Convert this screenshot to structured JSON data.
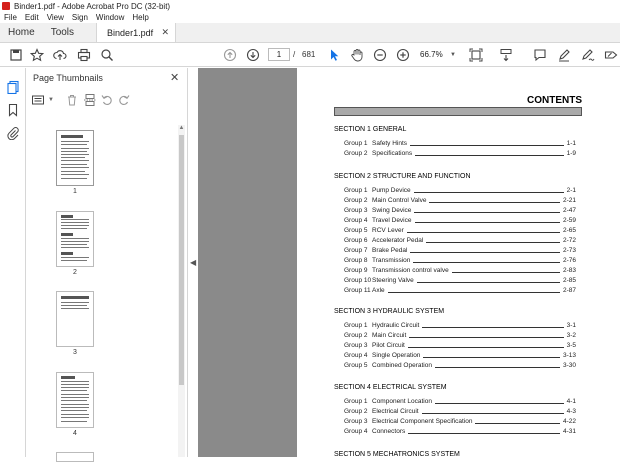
{
  "window": {
    "title": "Binder1.pdf - Adobe Acrobat Pro DC (32-bit)"
  },
  "menu": [
    "File",
    "Edit",
    "View",
    "Sign",
    "Window",
    "Help"
  ],
  "tabs": {
    "home": "Home",
    "tools": "Tools",
    "document": "Binder1.pdf"
  },
  "toolbar": {
    "page_current": "1",
    "page_separator": "/",
    "page_total": "681",
    "zoom": "66.7%"
  },
  "panel": {
    "title": "Page Thumbnails",
    "thumbnails": [
      "1",
      "2",
      "3",
      "4"
    ]
  },
  "document": {
    "contents_title": "CONTENTS",
    "sections": [
      {
        "title": "SECTION 1  GENERAL",
        "rows": [
          {
            "group": "Group  1",
            "name": "Safety Hints",
            "page": "1-1"
          },
          {
            "group": "Group  2",
            "name": "Specifications",
            "page": "1-9"
          }
        ]
      },
      {
        "title": "SECTION 2  STRUCTURE AND FUNCTION",
        "rows": [
          {
            "group": "Group  1",
            "name": "Pump Device",
            "page": "2-1"
          },
          {
            "group": "Group  2",
            "name": "Main Control Valve",
            "page": "2-21"
          },
          {
            "group": "Group  3",
            "name": "Swing Device",
            "page": "2-47"
          },
          {
            "group": "Group  4",
            "name": "Travel Device",
            "page": "2-59"
          },
          {
            "group": "Group  5",
            "name": "RCV Lever",
            "page": "2-65"
          },
          {
            "group": "Group  6",
            "name": "Accelerator Pedal",
            "page": "2-72"
          },
          {
            "group": "Group  7",
            "name": "Brake Pedal",
            "page": "2-73"
          },
          {
            "group": "Group  8",
            "name": "Transmission",
            "page": "2-76"
          },
          {
            "group": "Group  9",
            "name": "Transmission control valve",
            "page": "2-83"
          },
          {
            "group": "Group 10",
            "name": "Steering Valve",
            "page": "2-85"
          },
          {
            "group": "Group 11",
            "name": "Axle",
            "page": "2-87"
          }
        ]
      },
      {
        "title": "SECTION 3  HYDRAULIC SYSTEM",
        "rows": [
          {
            "group": "Group  1",
            "name": "Hydraulic Circuit",
            "page": "3-1"
          },
          {
            "group": "Group  2",
            "name": "Main Circuit",
            "page": "3-2"
          },
          {
            "group": "Group  3",
            "name": "Pilot Circuit",
            "page": "3-5"
          },
          {
            "group": "Group  4",
            "name": "Single Operation",
            "page": "3-13"
          },
          {
            "group": "Group  5",
            "name": "Combined Operation",
            "page": "3-30"
          }
        ]
      },
      {
        "title": "SECTION 4  ELECTRICAL SYSTEM",
        "rows": [
          {
            "group": "Group  1",
            "name": "Component Location",
            "page": "4-1"
          },
          {
            "group": "Group  2",
            "name": "Electrical Circuit",
            "page": "4-3"
          },
          {
            "group": "Group  3",
            "name": "Electrical Component Specification",
            "page": "4-22"
          },
          {
            "group": "Group  4",
            "name": "Connectors",
            "page": "4-31"
          }
        ]
      },
      {
        "title": "SECTION 5  MECHATRONICS SYSTEM",
        "rows": []
      }
    ]
  }
}
